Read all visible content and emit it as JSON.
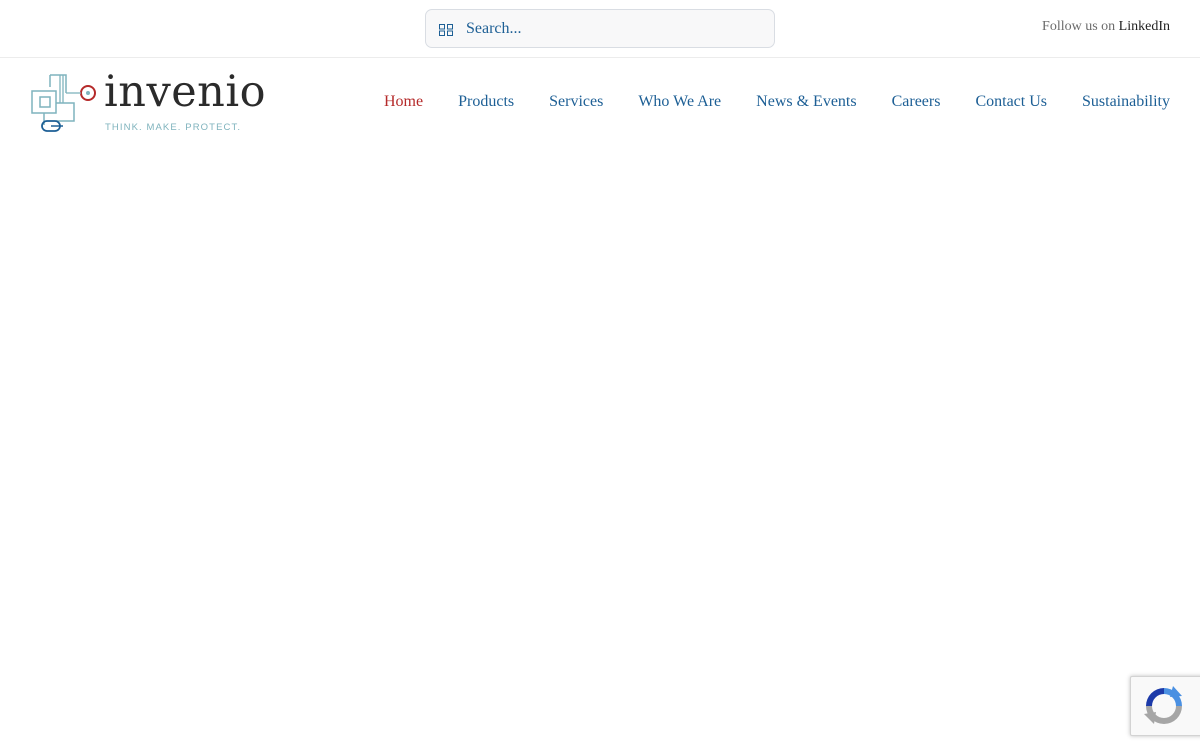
{
  "search": {
    "placeholder": "Search..."
  },
  "social": {
    "prefix": "Follow us on",
    "link_label": "LinkedIn"
  },
  "logo": {
    "wordmark": "invenio",
    "tagline": "THINK. MAKE. PROTECT."
  },
  "nav": {
    "items": [
      {
        "label": "Home",
        "active": true
      },
      {
        "label": "Products"
      },
      {
        "label": "Services"
      },
      {
        "label": "Who We Are"
      },
      {
        "label": "News & Events"
      },
      {
        "label": "Careers"
      },
      {
        "label": "Contact Us"
      },
      {
        "label": "Sustainability"
      }
    ]
  },
  "colors": {
    "nav_link": "#1d5f95",
    "nav_active": "#b52a2a",
    "logo_accent_red": "#b52a2a",
    "logo_accent_teal": "#7fb3bd"
  },
  "widgets": {
    "recaptcha_icon": "recaptcha-icon"
  }
}
